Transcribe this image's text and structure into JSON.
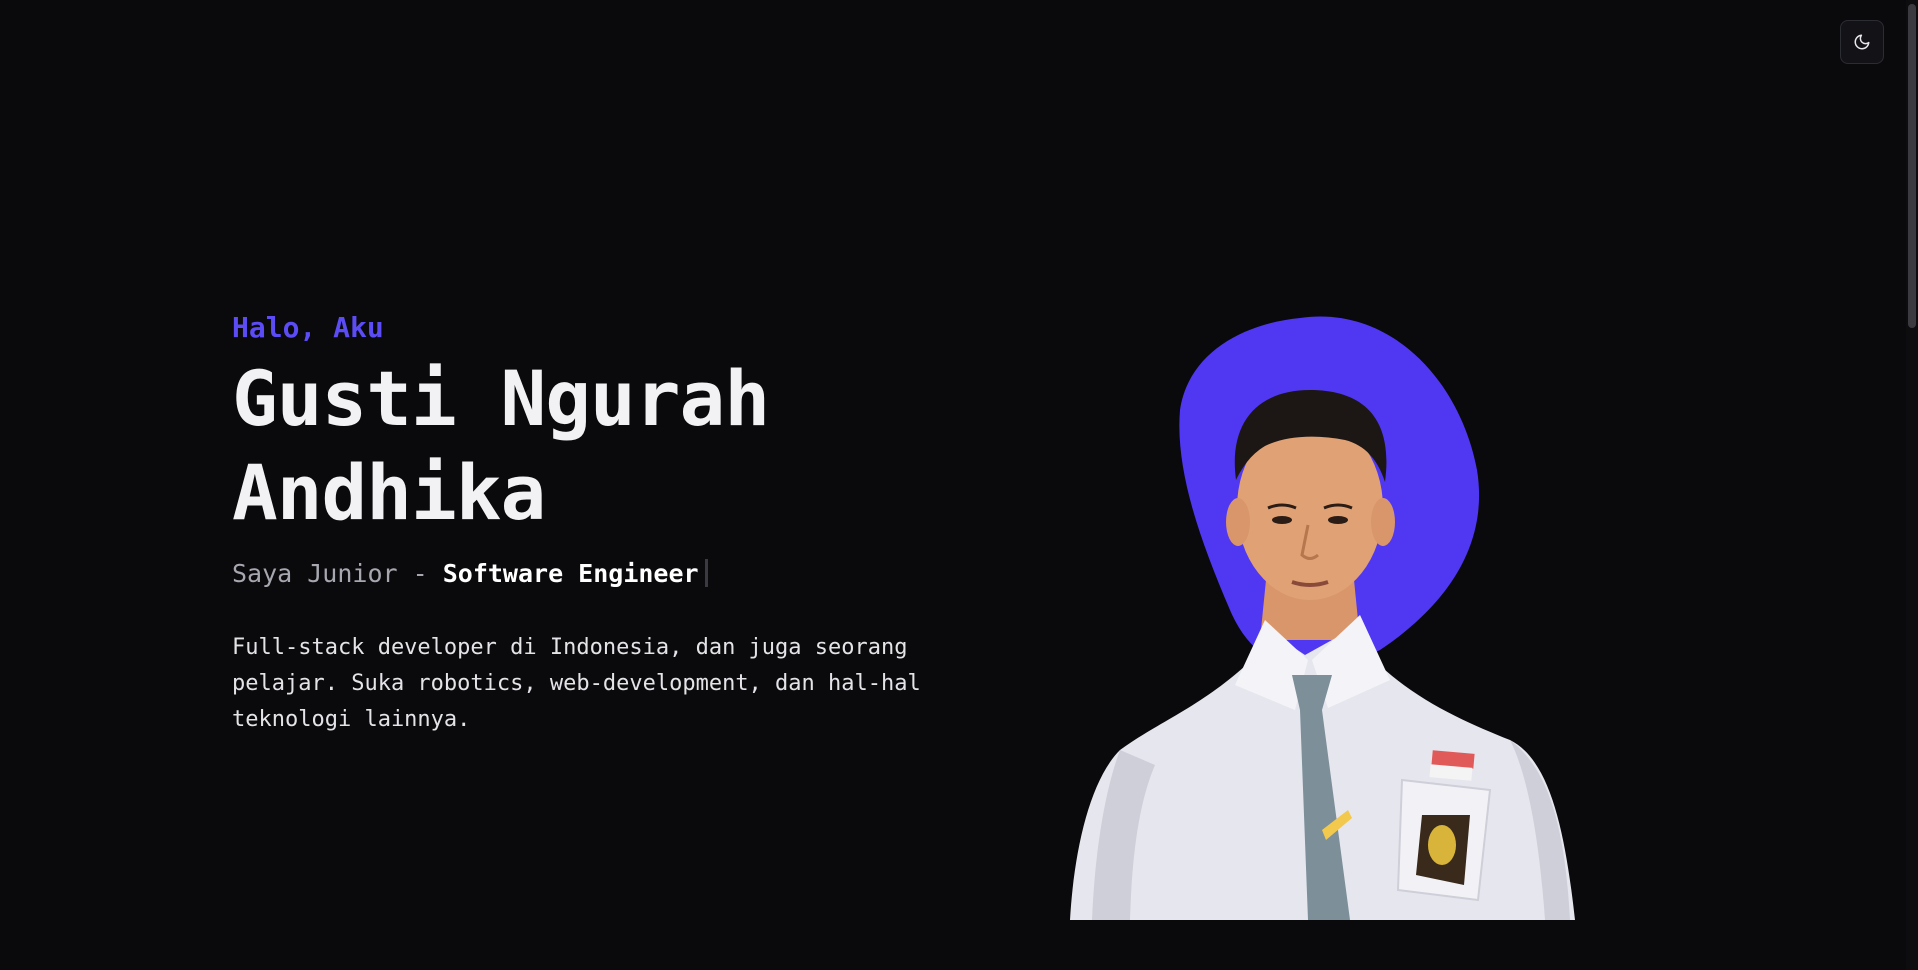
{
  "hero": {
    "greeting": "Halo, Aku",
    "name_line1": "Gusti Ngurah",
    "name_line2": "Andhika",
    "role_prefix": "Saya Junior - ",
    "role_title": "Software Engineer",
    "bio": "Full-stack developer di Indonesia, dan juga seorang pelajar. Suka robotics, web-development, dan hal-hal teknologi lainnya."
  },
  "theme_toggle": {
    "icon": "moon-icon"
  },
  "portrait": {
    "alt": "Gusti Ngurah Andhika",
    "blob_color": "#5038f2"
  },
  "colors": {
    "background": "#0a0a0d",
    "accent": "#5b4cf5",
    "text_primary": "#f2f2f4",
    "text_muted": "#a7a7b0"
  }
}
